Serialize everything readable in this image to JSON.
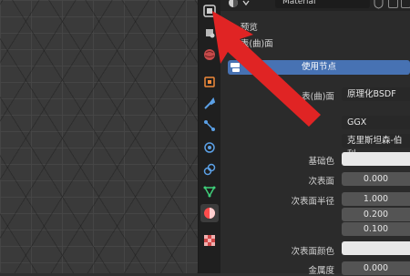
{
  "header": {
    "material_name": "Material"
  },
  "panel": {
    "preview_label": "预览",
    "surface_section_label": "表(曲)面",
    "use_nodes_label": "使用节点"
  },
  "properties": {
    "surface": {
      "label": "表(曲)面",
      "value": "原理化BSDF"
    },
    "distribution": {
      "value": "GGX"
    },
    "subsurface_method": {
      "value": "克里斯坦森-伯利"
    },
    "base_color": {
      "label": "基础色"
    },
    "subsurface": {
      "label": "次表面",
      "value": "0.000"
    },
    "subsurface_radius": {
      "label": "次表面半径",
      "values": [
        "1.000",
        "0.200",
        "0.100"
      ]
    },
    "subsurface_color": {
      "label": "次表面颜色"
    },
    "metallic": {
      "label": "金属度",
      "value": "0.000"
    }
  },
  "tabs": [
    "tool-icon",
    "render-icon",
    "output-icon",
    "view-layer-icon",
    "scene-icon",
    "world-icon",
    "object-icon",
    "modifier-icon",
    "particles-icon",
    "physics-icon",
    "constraints-icon",
    "data-icon",
    "material-icon",
    "texture-icon"
  ],
  "colors": {
    "accent": "#4772b3",
    "annotation_arrow": "#e02424",
    "material_tab": "#ff4d4d"
  }
}
